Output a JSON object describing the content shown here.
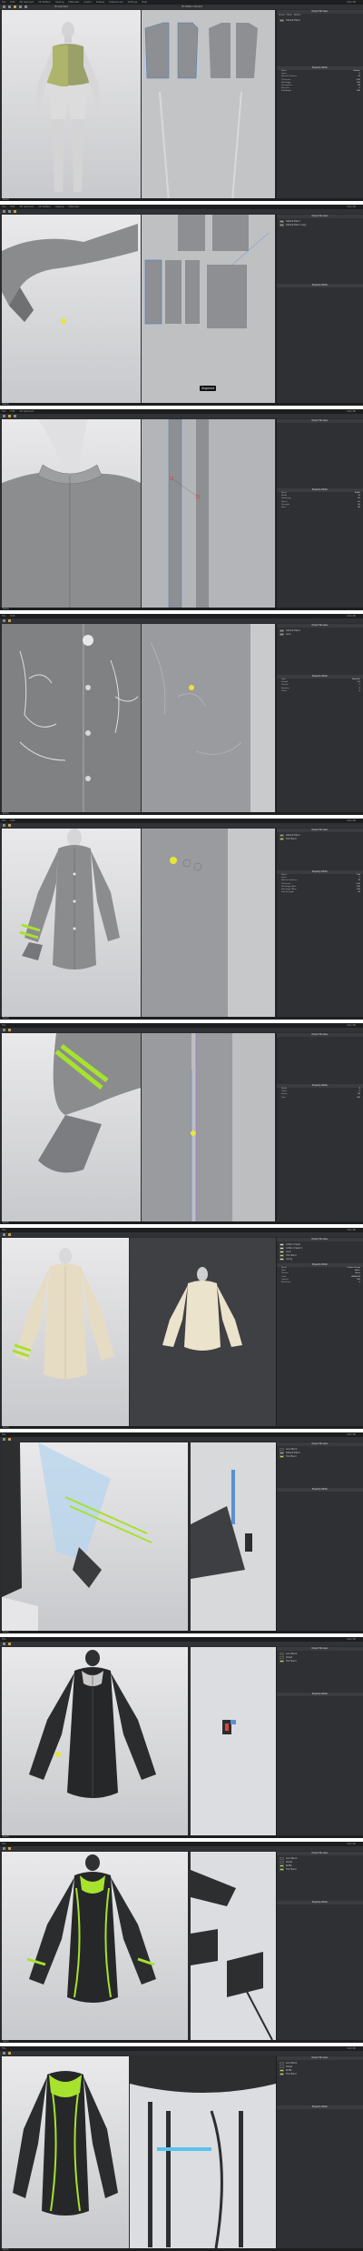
{
  "app": {
    "menu": [
      "File",
      "Edit",
      "3D Garment",
      "2D Pattern",
      "Sewing",
      "Materials",
      "Avatar",
      "Display",
      "Preferences",
      "Settings",
      "Help"
    ],
    "window_title": "CLO-3D",
    "view_3d_label": "3D Garment",
    "view_2d_label": "2D Pattern Window",
    "panel_title": "Object Browser",
    "panel_tabs": [
      "Scene",
      "Fabric",
      "Button",
      "Buttonhole",
      "Topstitch",
      "Trim"
    ],
    "property_title": "Property Editor",
    "status_text": "Ready",
    "accent_color": "#a6e22e",
    "ui_bg": "#2b2c2f"
  },
  "frames": [
    {
      "id": 1,
      "fabrics": [
        "Default Fabric"
      ],
      "properties": [
        {
          "k": "Name",
          "v": "Pattern"
        },
        {
          "k": "Layer",
          "v": "0"
        },
        {
          "k": "Particle Distance",
          "v": "20"
        },
        {
          "k": "Thickness",
          "v": "1.00"
        },
        {
          "k": "Shrinkage",
          "v": "100"
        },
        {
          "k": "Strengthen",
          "v": "Off"
        },
        {
          "k": "Pressure",
          "v": "0"
        },
        {
          "k": "Fold Angle",
          "v": "180"
        }
      ]
    },
    {
      "id": 2,
      "fabrics": [
        "Default Fabric",
        "Default Fabric Copy"
      ],
      "tooltip": "Segment",
      "properties": []
    },
    {
      "id": 3,
      "fabrics": [
        "Default Fabric"
      ],
      "properties": [
        {
          "k": "Name",
          "v": "Ruffle"
        },
        {
          "k": "Width",
          "v": "12"
        },
        {
          "k": "Gathering",
          "v": "1.8"
        },
        {
          "k": "Elastic",
          "v": "On"
        },
        {
          "k": "Strength",
          "v": "50"
        },
        {
          "k": "Ratio",
          "v": "80"
        }
      ]
    },
    {
      "id": 4,
      "fabrics": [
        "Default Fabric",
        "Lace"
      ],
      "properties": [
        {
          "k": "Type",
          "v": "Topstitch"
        },
        {
          "k": "Length",
          "v": "2.5"
        },
        {
          "k": "Thread",
          "v": "1"
        },
        {
          "k": "Spacing",
          "v": "3"
        },
        {
          "k": "Offset",
          "v": "0"
        }
      ]
    },
    {
      "id": 5,
      "fabrics": [
        "Default Fabric",
        "Trim Band"
      ],
      "properties": [
        {
          "k": "Name",
          "v": "Cuff"
        },
        {
          "k": "Layer",
          "v": "1"
        },
        {
          "k": "Particle Distance",
          "v": "10"
        },
        {
          "k": "Thickness",
          "v": "1.50"
        },
        {
          "k": "Shrinkage Weft",
          "v": "100"
        },
        {
          "k": "Shrinkage Warp",
          "v": "100"
        },
        {
          "k": "Fold Strength",
          "v": "30"
        }
      ]
    },
    {
      "id": 6,
      "fabrics": [
        "Default Fabric"
      ],
      "properties": [
        {
          "k": "Width",
          "v": "8"
        },
        {
          "k": "Offset",
          "v": "0"
        },
        {
          "k": "Elastic",
          "v": "Off"
        },
        {
          "k": "Fold",
          "v": "180"
        }
      ]
    },
    {
      "id": 7,
      "fabrics": [
        "Cotton Cream",
        "Cotton Cream 2",
        "Lace",
        "Trim Band",
        "Lining"
      ],
      "properties": [
        {
          "k": "Name",
          "v": "Cotton Cream"
        },
        {
          "k": "Type",
          "v": "Fabric"
        },
        {
          "k": "Texture",
          "v": "None"
        },
        {
          "k": "Color",
          "v": "#E8DFCB"
        },
        {
          "k": "Opacity",
          "v": "100"
        },
        {
          "k": "Reflection",
          "v": "0"
        }
      ]
    },
    {
      "id": 8,
      "fabrics": [
        "Lace Black",
        "Default Fabric",
        "Trim Band"
      ],
      "properties": []
    },
    {
      "id": 9,
      "fabrics": [
        "Lace Black",
        "Velvet",
        "Trim Band"
      ],
      "properties": []
    },
    {
      "id": 10,
      "fabrics": [
        "Lace Black",
        "Velvet",
        "Ruffle",
        "Trim Band"
      ],
      "properties": []
    },
    {
      "id": 11,
      "fabrics": [
        "Lace Black",
        "Velvet",
        "Ruffle",
        "Trim Band"
      ],
      "properties": []
    }
  ]
}
